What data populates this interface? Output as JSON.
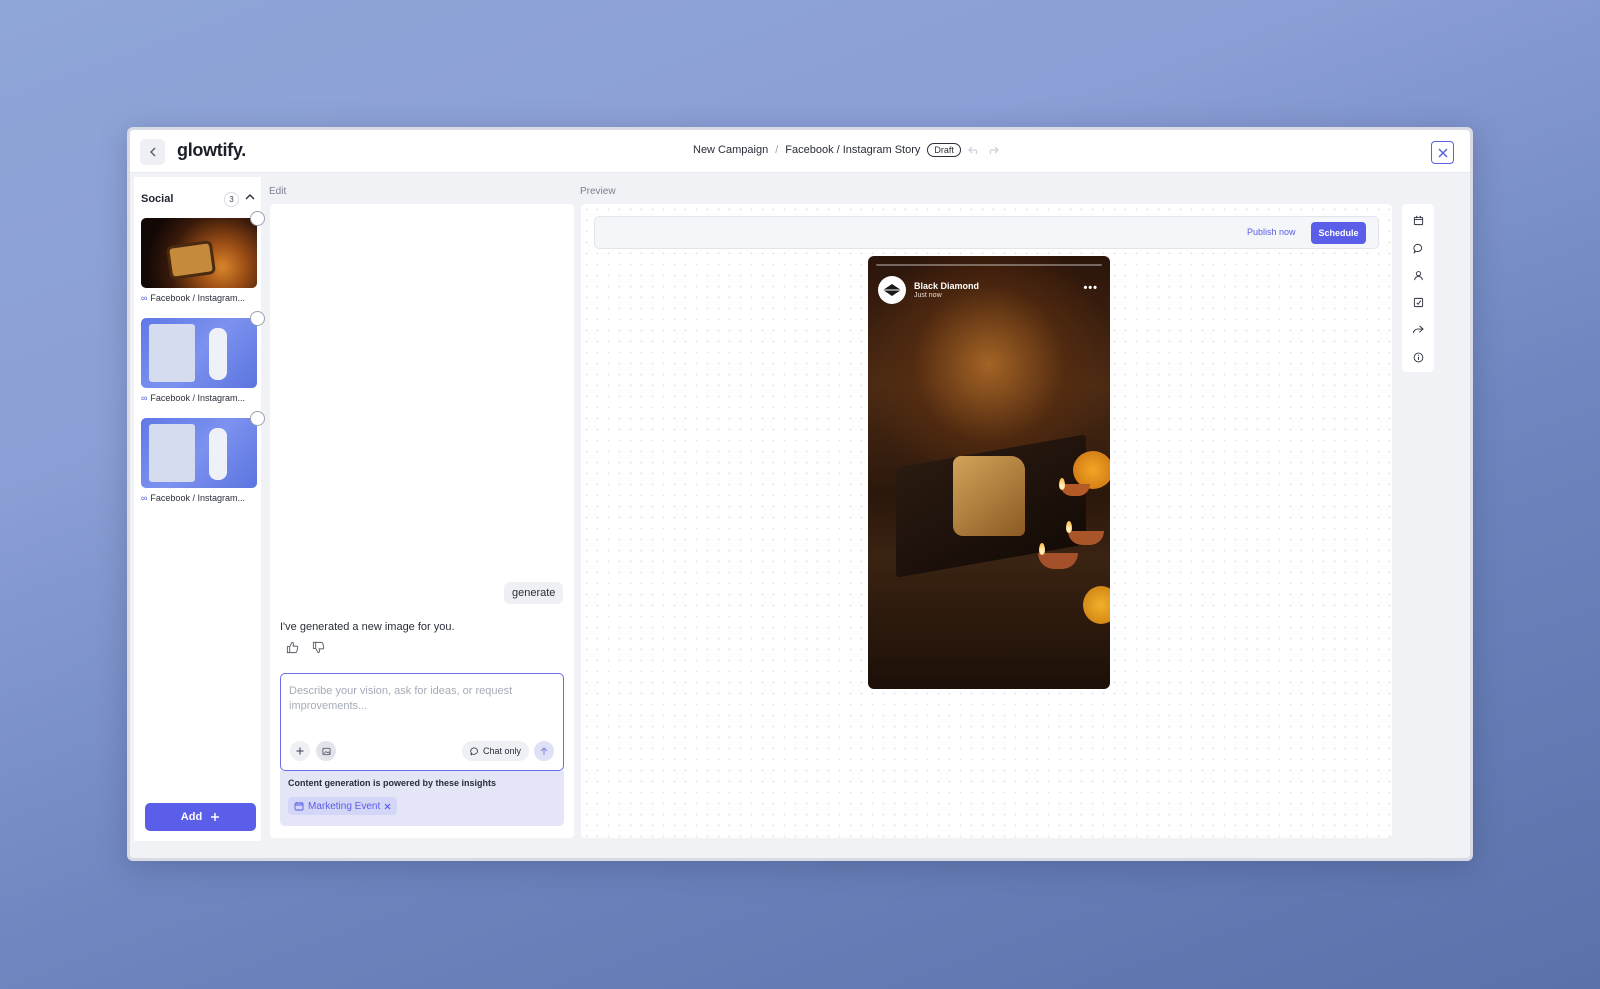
{
  "header": {
    "logo": "glowtify.",
    "breadcrumb": [
      "New Campaign",
      "Facebook / Instagram Story"
    ],
    "separator": "/",
    "status_badge": "Draft"
  },
  "sidebar": {
    "section_title": "Social",
    "count": "3",
    "items": [
      {
        "label": "Facebook / Instagram...",
        "thumbnail": "food-diya-scene"
      },
      {
        "label": "Facebook / Instagram...",
        "thumbnail": "fashion-blue-collage"
      },
      {
        "label": "Facebook / Instagram...",
        "thumbnail": "fashion-blue-collage"
      }
    ],
    "add_label": "Add"
  },
  "edit": {
    "section_label": "Edit",
    "user_message": "generate",
    "assistant_message": "I've generated a new image for you.",
    "prompt": {
      "value": "",
      "placeholder": "Describe your vision, ask for ideas, or request improvements...",
      "chat_only_label": "Chat only"
    },
    "insights": {
      "title": "Content generation is powered by these insights",
      "chips": [
        "Marketing Event"
      ]
    }
  },
  "preview": {
    "section_label": "Preview",
    "publish_now_label": "Publish now",
    "schedule_label": "Schedule",
    "story": {
      "account_name": "Black Diamond",
      "timestamp": "Just now",
      "image": "cheese-board-diyas-marigolds"
    }
  },
  "right_rail": {
    "icons": [
      "calendar-icon",
      "comment-icon",
      "user-icon",
      "checklist-icon",
      "share-icon",
      "info-icon"
    ]
  },
  "colors": {
    "accent": "#5a5ee8",
    "chip_bg": "#e4e6f8"
  }
}
